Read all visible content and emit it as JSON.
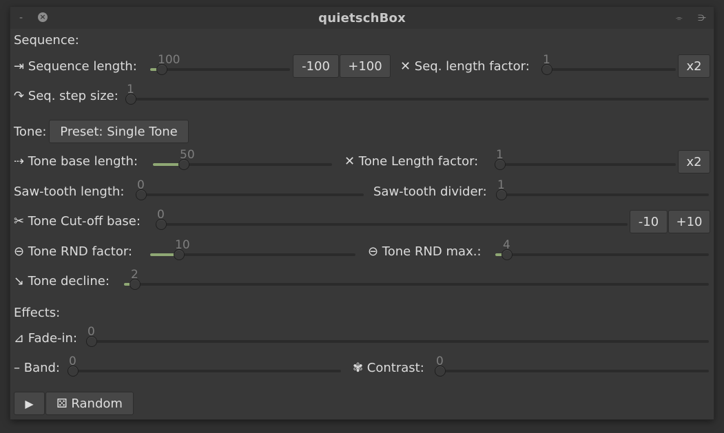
{
  "window": {
    "title": "quietschBox",
    "minimize_glyph": "-",
    "close_glyph": "×",
    "menu_glyph": "⌯",
    "pin_glyph": "⋺"
  },
  "sections": {
    "sequence": "Sequence:",
    "tone": "Tone:",
    "effects": "Effects:"
  },
  "labels": {
    "seq_length": "⇥ Sequence length:",
    "seq_length_factor": "✕ Seq. length factor:",
    "seq_step_size": "↷ Seq. step size:",
    "tone_base_length": "⇢ Tone base length:",
    "tone_length_factor": "✕ Tone Length factor:",
    "sawtooth_length": "Saw-tooth length:",
    "sawtooth_divider": "Saw-tooth divider:",
    "tone_cutoff_base": "✂ Tone Cut-off base:",
    "tone_rnd_factor": "⊖ Tone RND factor:",
    "tone_rnd_max": "⊖ Tone RND max.:",
    "tone_decline": "↘ Tone decline:",
    "fade_in": "⊿ Fade-in:",
    "band": "– Band:",
    "contrast": "✾ Contrast:"
  },
  "values": {
    "seq_length": "100",
    "seq_length_factor": "1",
    "seq_step_size": "1",
    "tone_base_length": "50",
    "tone_length_factor": "1",
    "sawtooth_length": "0",
    "sawtooth_divider": "1",
    "tone_cutoff_base": "0",
    "tone_rnd_factor": "10",
    "tone_rnd_max": "4",
    "tone_decline": "2",
    "fade_in": "0",
    "band": "0",
    "contrast": "0"
  },
  "buttons": {
    "minus_100": "-100",
    "plus_100": "+100",
    "seq_x2": "x2",
    "preset": "Preset: Single Tone",
    "tone_x2": "x2",
    "minus_10": "-10",
    "plus_10": "+10",
    "play": "▶",
    "random": "⚄ Random"
  },
  "colors": {
    "slider_fill": "#8fa874",
    "window_bg": "#383838"
  }
}
